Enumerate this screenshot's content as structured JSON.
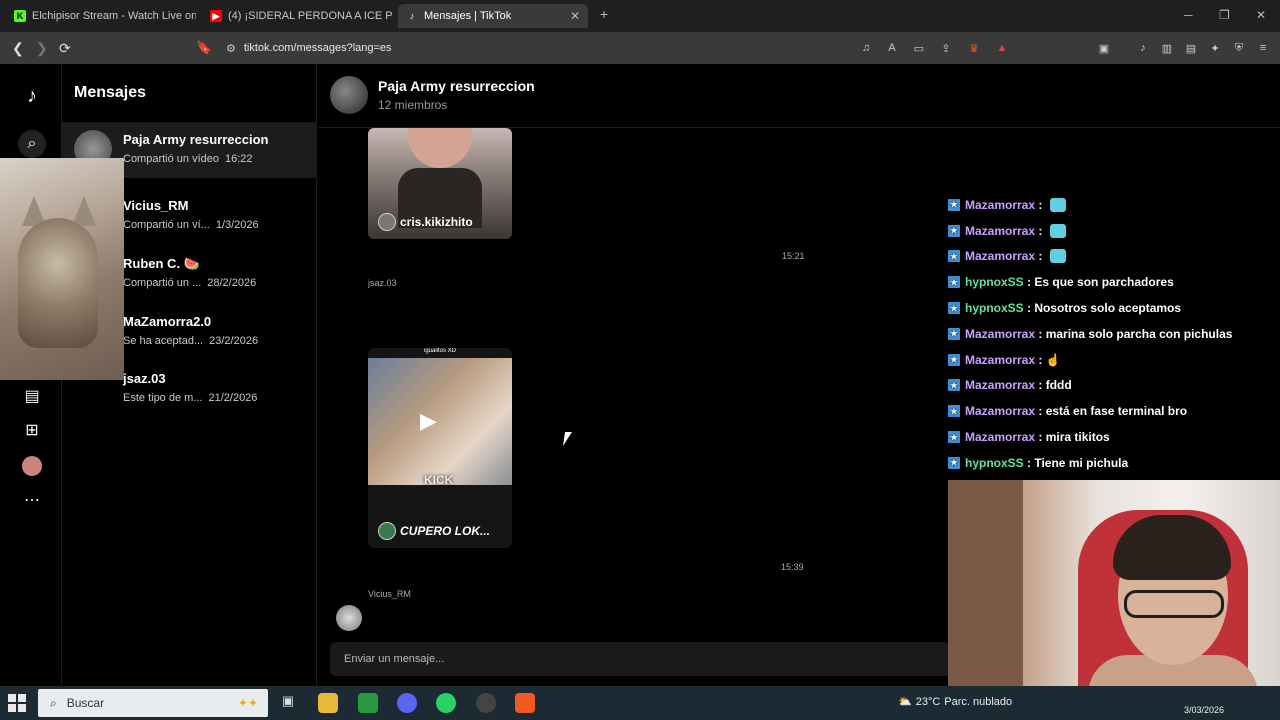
{
  "browser": {
    "tabs": [
      {
        "title": "Elchipisor Stream - Watch Live on Ki",
        "icon_color": "#53fc18"
      },
      {
        "title": "(4) ¡SIDERAL PERDONA A ICE POSEID",
        "icon_color": "#ff0000"
      },
      {
        "title": "Mensajes | TikTok",
        "icon_color": "#ffffff"
      }
    ],
    "new_tab": "+",
    "url": "tiktok.com/messages?lang=es"
  },
  "sidebar": {
    "title": "Mensajes",
    "conversations": [
      {
        "name": "Paja Army resurreccion",
        "preview": "Compartió un vídeo",
        "date": "16:22"
      },
      {
        "name": "Vicius_RM",
        "preview": "Compartió un ví...",
        "date": "1/3/2026"
      },
      {
        "name": "Ruben C. 🍉",
        "preview": "Compartió un ...",
        "date": "28/2/2026"
      },
      {
        "name": "MaZamorra2.0",
        "preview": "Se ha aceptad...",
        "date": "23/2/2026"
      },
      {
        "name": "jsaz.03",
        "preview": "Este tipo de m...",
        "date": "21/2/2026"
      }
    ]
  },
  "chat": {
    "title": "Paja Army resurreccion",
    "members": "12 miembros",
    "video1_user": "cris.kikizhito",
    "time1": "15:21",
    "sender1": "jsaz.03",
    "video2_caption": "igualitos XD",
    "video2_user": "CUPERO LOK...",
    "video2_watermark": "KICK",
    "time2": "15:39",
    "sender2": "Vicius_RM",
    "input_placeholder": "Enviar un mensaje..."
  },
  "stream_chat": [
    {
      "user": "Mazamorrax",
      "msg": "",
      "emote": true,
      "color": "purple"
    },
    {
      "user": "Mazamorrax",
      "msg": "",
      "emote": true,
      "color": "purple"
    },
    {
      "user": "Mazamorrax",
      "msg": "",
      "emote": true,
      "color": "purple"
    },
    {
      "user": "hypnoxSS",
      "msg": "Es que son parchadores",
      "emote": false,
      "color": "green"
    },
    {
      "user": "hypnoxSS",
      "msg": "Nosotros solo aceptamos",
      "emote": false,
      "color": "green"
    },
    {
      "user": "Mazamorrax",
      "msg": "marina solo parcha con pichulas",
      "emote": false,
      "color": "purple"
    },
    {
      "user": "Mazamorrax",
      "msg": "☝",
      "emote": false,
      "color": "purple"
    },
    {
      "user": "Mazamorrax",
      "msg": "fddd",
      "emote": false,
      "color": "purple"
    },
    {
      "user": "Mazamorrax",
      "msg": "está en fase terminal bro",
      "emote": false,
      "color": "purple"
    },
    {
      "user": "Mazamorrax",
      "msg": "mira tikitos",
      "emote": false,
      "color": "purple"
    },
    {
      "user": "hypnoxSS",
      "msg": "Tiene mi pichula",
      "emote": false,
      "color": "green"
    }
  ],
  "taskbar": {
    "search_label": "Buscar",
    "weather": "23°C",
    "weather_desc": "Parc. nublado",
    "date": "3/03/2026"
  },
  "colors": {
    "accent_purple": "#c9a0ff",
    "accent_green": "#5fe0a0",
    "badge_blue": "#3d8fd6"
  }
}
